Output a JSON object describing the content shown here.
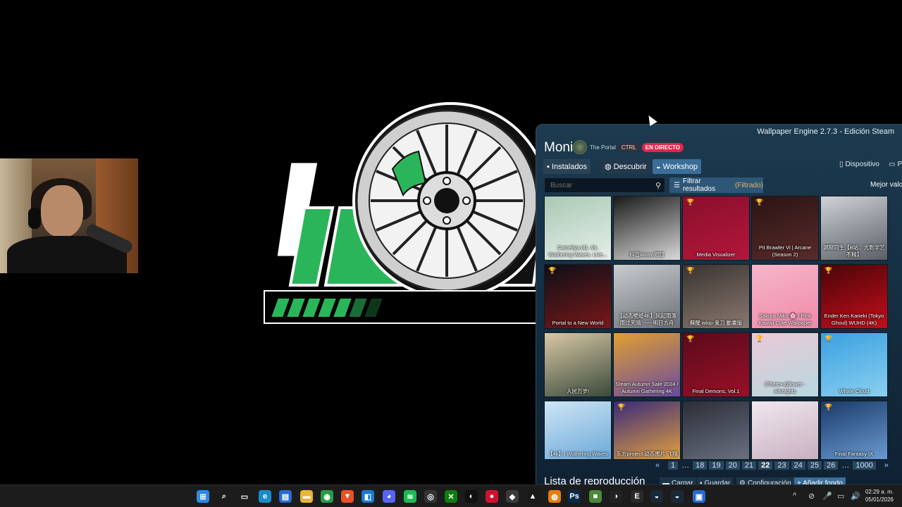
{
  "window": {
    "title": "Wallpaper Engine 2.7.3 - Edición Steam",
    "monitor_label": "Moni"
  },
  "stream_overlay": {
    "channel": "The Portal",
    "ctrl": "CTRL",
    "live": "EN DIRECTO"
  },
  "tabs": [
    {
      "label": "Instalados",
      "icon": "save-icon"
    },
    {
      "label": "Descubrir",
      "icon": "compass-icon"
    },
    {
      "label": "Workshop",
      "icon": "steam-icon"
    }
  ],
  "right_tabs": [
    {
      "label": "Dispositivo",
      "icon": "phone-icon"
    },
    {
      "label": "Pa",
      "icon": "monitor-icon"
    }
  ],
  "search": {
    "placeholder": "Buscar",
    "icon": "search-icon"
  },
  "filter": {
    "label": "Filtrar resultados",
    "state": "(Filtrado)"
  },
  "sort": {
    "label": "Mejor valor"
  },
  "wallpapers": [
    {
      "title": "Cameliya (4). 4K, Wuthering Waves. Live...",
      "trophy": false,
      "colors": [
        "#a9c9b5",
        "#e6efe8"
      ]
    },
    {
      "title": "抖音kkoyo頭目",
      "trophy": false,
      "colors": [
        "#1a1a1a",
        "#d9d9d9"
      ]
    },
    {
      "title": "Media Visualizer",
      "trophy": true,
      "colors": [
        "#8a0f2c",
        "#b3163a"
      ]
    },
    {
      "title": "Pit Brawler Vi | Arcane (Season 2)",
      "trophy": true,
      "colors": [
        "#2a1414",
        "#5a2a2a"
      ]
    },
    {
      "title": "洞窟同生【B站：光影学艺不精】",
      "trophy": false,
      "colors": [
        "#cfd3d8",
        "#5a5f66"
      ]
    },
    {
      "title": "Portal to a New World",
      "trophy": true,
      "colors": [
        "#0d0f18",
        "#7a1818"
      ]
    },
    {
      "title": "【动态壁纸4K】风起雨落 雨过天晴 一一明日方舟",
      "trophy": false,
      "colors": [
        "#c8ccd0",
        "#6c7074"
      ]
    },
    {
      "title": "蘇醒 wlop-鬼刀 動畫版",
      "trophy": true,
      "colors": [
        "#3a3330",
        "#8a7a70"
      ]
    },
    {
      "title": "Sakura Miku 🌸 / Pink Kawaii Cute Wallpaper",
      "trophy": false,
      "colors": [
        "#f5b6cb",
        "#f08aa8"
      ]
    },
    {
      "title": "Ender Ken Kaneki (Tokyo Ghoul) WUHD (4K)",
      "trophy": true,
      "colors": [
        "#4a0508",
        "#c40e1c"
      ]
    },
    {
      "title": "人民万岁!",
      "trophy": false,
      "colors": [
        "#d9c8a6",
        "#3a4a3a"
      ]
    },
    {
      "title": "Steam Autumn Sale 2024 / Autumn Gathering 4K",
      "trophy": false,
      "colors": [
        "#e0a030",
        "#6a4aa0"
      ]
    },
    {
      "title": "Final Demons, Vol.1",
      "trophy": true,
      "colors": [
        "#5a0a1a",
        "#9a1028"
      ]
    },
    {
      "title": "(There+a)flower - Arknights",
      "trophy": true,
      "colors": [
        "#e9c9d6",
        "#b8d8e0"
      ]
    },
    {
      "title": "Whale Cloud",
      "trophy": true,
      "colors": [
        "#3aa0e0",
        "#8ad0f0"
      ]
    },
    {
      "title": "【4k】| Wuthering Waves",
      "trophy": false,
      "colors": [
        "#cfe6f5",
        "#6aa8d8"
      ]
    },
    {
      "title": "东方project 动态图片 飞翔",
      "trophy": true,
      "colors": [
        "#3a2a7a",
        "#e0a040"
      ]
    },
    {
      "title": "",
      "trophy": false,
      "colors": [
        "#2a2e38",
        "#6a7080"
      ]
    },
    {
      "title": "",
      "trophy": false,
      "colors": [
        "#f0e8ee",
        "#c8b0c0"
      ]
    },
    {
      "title": "Final Fantasy IX",
      "trophy": true,
      "colors": [
        "#1a3a6a",
        "#6a9ad0"
      ]
    }
  ],
  "pagination": {
    "prev": "«",
    "next": "»",
    "pages": [
      "1",
      "…",
      "18",
      "19",
      "20",
      "21",
      "22",
      "23",
      "24",
      "25",
      "26",
      "…",
      "1000"
    ],
    "current": "22"
  },
  "playlist": {
    "title": "Lista de reproducción",
    "load": "Cargar",
    "save": "Guardar",
    "config": "Configuración",
    "add": "+ Añadir fondo"
  },
  "taskbar": {
    "time": "02:29 a. m.",
    "date": "05/01/2026",
    "apps": [
      {
        "name": "start-icon",
        "color": "#2b8be8",
        "glyph": "⊞"
      },
      {
        "name": "search-icon",
        "color": "transparent",
        "glyph": "⌕"
      },
      {
        "name": "task-view-icon",
        "color": "transparent",
        "glyph": "▭"
      },
      {
        "name": "edge-icon",
        "color": "#1a8cc8",
        "glyph": "e"
      },
      {
        "name": "store-icon",
        "color": "#2a6ad0",
        "glyph": "▤"
      },
      {
        "name": "explorer-icon",
        "color": "#e8b43a",
        "glyph": "▬"
      },
      {
        "name": "chrome-icon",
        "color": "#2a9a4a",
        "glyph": "◉"
      },
      {
        "name": "brave-icon",
        "color": "#e8502a",
        "glyph": "▼"
      },
      {
        "name": "vscode-icon",
        "color": "#1a7ad0",
        "glyph": "◧"
      },
      {
        "name": "discord-icon",
        "color": "#5865f2",
        "glyph": "◕"
      },
      {
        "name": "spotify-icon",
        "color": "#1db954",
        "glyph": "≋"
      },
      {
        "name": "obs-icon",
        "color": "#333",
        "glyph": "◎"
      },
      {
        "name": "xbox-icon",
        "color": "#107c10",
        "glyph": "✕"
      },
      {
        "name": "capcut-icon",
        "color": "#111",
        "glyph": "◐"
      },
      {
        "name": "record-icon",
        "color": "#d01030",
        "glyph": "●"
      },
      {
        "name": "davinci-icon",
        "color": "#3a3a3a",
        "glyph": "◆"
      },
      {
        "name": "vlc-icon",
        "color": "#1a1a1a",
        "glyph": "▲"
      },
      {
        "name": "blender-icon",
        "color": "#e87d0d",
        "glyph": "◍"
      },
      {
        "name": "photoshop-icon",
        "color": "#0a2a4a",
        "glyph": "Ps"
      },
      {
        "name": "minecraft-icon",
        "color": "#4a8a3a",
        "glyph": "■"
      },
      {
        "name": "github-icon",
        "color": "#222",
        "glyph": "◑"
      },
      {
        "name": "epic-icon",
        "color": "#2a2a2a",
        "glyph": "E"
      },
      {
        "name": "steam-icon",
        "color": "#1b2838",
        "glyph": "◒"
      },
      {
        "name": "steam-2-icon",
        "color": "#1b2838",
        "glyph": "◒"
      },
      {
        "name": "wallpaper-engine-icon",
        "color": "#2a6ad0",
        "glyph": "▣"
      }
    ],
    "tray": [
      "^",
      "⊘",
      "🎤",
      "▭",
      "🔊"
    ]
  }
}
